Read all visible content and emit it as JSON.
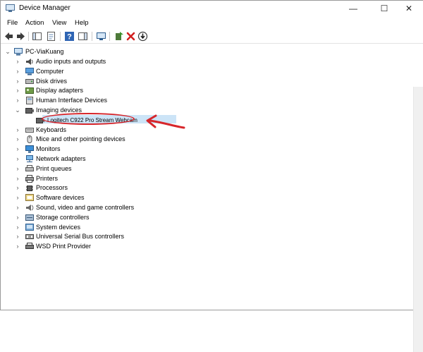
{
  "window": {
    "title": "Device Manager",
    "controls": {
      "minimize": "—",
      "maximize": "☐",
      "close": "✕"
    }
  },
  "menu": [
    "File",
    "Action",
    "View",
    "Help"
  ],
  "toolbar": [
    "back-icon",
    "forward-icon",
    "console-tree-icon",
    "properties-icon",
    "help-icon",
    "action-pane-icon",
    "scan-hardware-icon",
    "update-driver-icon",
    "uninstall-icon",
    "disable-icon"
  ],
  "tree": {
    "root": "PC-ViaKuang",
    "categories": [
      {
        "label": "Audio inputs and outputs",
        "icon": "speaker-icon"
      },
      {
        "label": "Computer",
        "icon": "computer-icon"
      },
      {
        "label": "Disk drives",
        "icon": "disk-icon"
      },
      {
        "label": "Display adapters",
        "icon": "display-adapter-icon"
      },
      {
        "label": "Human Interface Devices",
        "icon": "hid-icon"
      },
      {
        "label": "Imaging devices",
        "icon": "camera-icon",
        "expanded": true
      },
      {
        "label": "Keyboards",
        "icon": "keyboard-icon"
      },
      {
        "label": "Mice and other pointing devices",
        "icon": "mouse-icon"
      },
      {
        "label": "Monitors",
        "icon": "monitor-icon"
      },
      {
        "label": "Network adapters",
        "icon": "network-icon"
      },
      {
        "label": "Print queues",
        "icon": "print-queue-icon"
      },
      {
        "label": "Printers",
        "icon": "printer-icon"
      },
      {
        "label": "Processors",
        "icon": "processor-icon"
      },
      {
        "label": "Software devices",
        "icon": "software-device-icon"
      },
      {
        "label": "Sound, video and game controllers",
        "icon": "sound-icon"
      },
      {
        "label": "Storage controllers",
        "icon": "storage-icon"
      },
      {
        "label": "System devices",
        "icon": "system-device-icon"
      },
      {
        "label": "Universal Serial Bus controllers",
        "icon": "usb-icon"
      },
      {
        "label": "WSD Print Provider",
        "icon": "wsd-icon"
      }
    ],
    "imaging_child": "Logitech C922 Pro Stream Webcam"
  },
  "colors": {
    "selection": "#cce4f7",
    "annotation": "#d7262b"
  }
}
